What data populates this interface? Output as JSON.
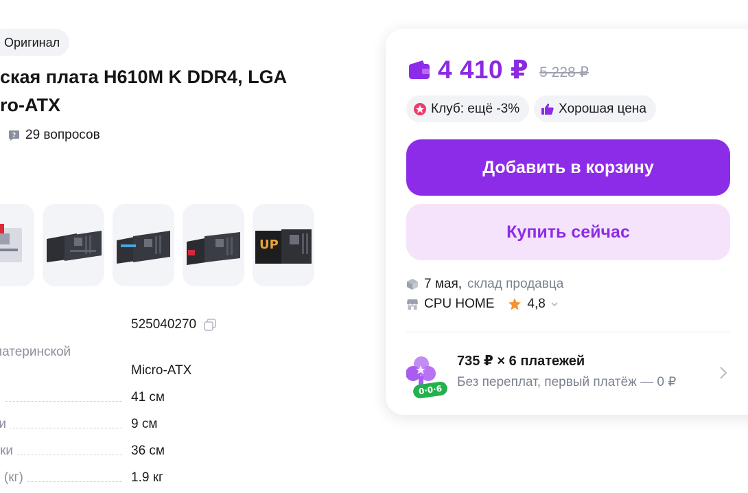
{
  "product": {
    "badge": "Оригинал",
    "title": "ская плата H610M K DDR4, LGA\nro-ATX",
    "questions": "29 вопросов"
  },
  "specs": [
    {
      "label": "",
      "value": "525040270",
      "copyable": true
    },
    {
      "label": "материнской",
      "value": "",
      "copyable": false
    },
    {
      "label": "",
      "value": "Micro-ATX",
      "copyable": false
    },
    {
      "label": "и",
      "value": "41 см",
      "copyable": false
    },
    {
      "label": "ки",
      "value": "9 см",
      "copyable": false
    },
    {
      "label": "вки",
      "value": "36 см",
      "copyable": false
    },
    {
      "label": "й (кг)",
      "value": "1.9 кг",
      "copyable": false
    }
  ],
  "purchase": {
    "price": "4 410 ₽",
    "old_price": "5 228 ₽",
    "chip_club": "Клуб: ещё -3%",
    "chip_good_price": "Хорошая цена",
    "add_to_cart": "Добавить в корзину",
    "buy_now": "Купить сейчас",
    "delivery_date": "7 мая,",
    "delivery_from": "склад продавца",
    "seller_name": "CPU HOME",
    "seller_rating": "4,8",
    "installment_title": "735 ₽ × 6 платежей",
    "installment_sub": "Без переплат, первый платёж — 0 ₽",
    "installment_badge": "0·0·6"
  },
  "colors": {
    "accent": "#8d2ce8",
    "accent_light": "#f5e3fb",
    "star": "#f5922f",
    "installment_green": "#22b24c"
  },
  "icons": [
    "question-bubble-icon",
    "copy-icon",
    "wallet-icon",
    "club-star-icon",
    "thumbs-up-icon",
    "box-icon",
    "store-icon",
    "star-icon",
    "chevron-down-icon",
    "chevron-right-icon",
    "installment-logo-icon"
  ]
}
